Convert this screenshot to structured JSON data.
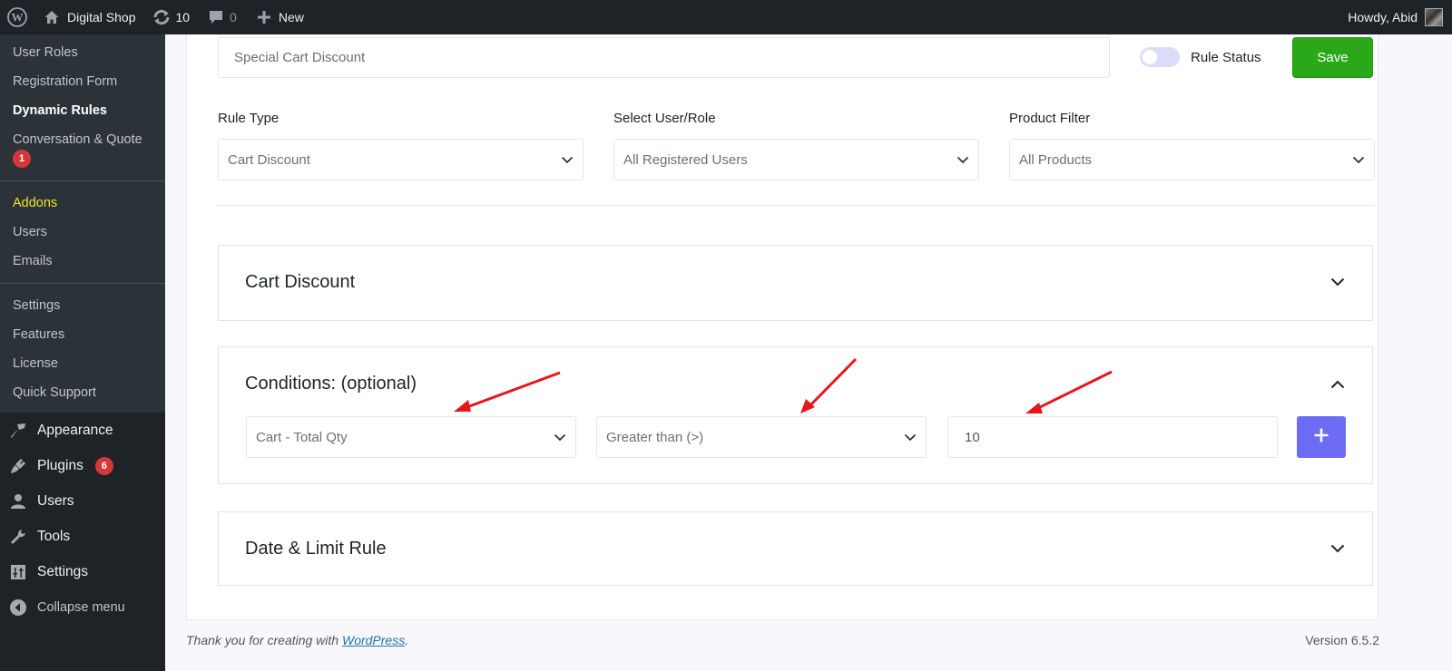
{
  "adminbar": {
    "site_name": "Digital Shop",
    "updates_count": "10",
    "comments_count": "0",
    "new_label": "New",
    "howdy": "Howdy, Abid",
    "icons": [
      "wordpress-logo-icon",
      "home-icon",
      "updates-icon",
      "comment-icon",
      "plus-icon",
      "avatar"
    ]
  },
  "sidebar": {
    "submenu_group1": [
      {
        "label": "User Roles"
      },
      {
        "label": "Registration Form"
      },
      {
        "label": "Dynamic Rules",
        "current": true
      },
      {
        "label": "Conversation & Quote",
        "badge": "1"
      }
    ],
    "submenu_group2": [
      {
        "label": "Addons",
        "highlight": true
      },
      {
        "label": "Users"
      },
      {
        "label": "Emails"
      }
    ],
    "submenu_group3": [
      {
        "label": "Settings"
      },
      {
        "label": "Features"
      },
      {
        "label": "License"
      },
      {
        "label": "Quick Support"
      }
    ],
    "menu": [
      {
        "label": "Appearance",
        "icon": "paintbrush-icon"
      },
      {
        "label": "Plugins",
        "icon": "plugin-icon",
        "badge": "6"
      },
      {
        "label": "Users",
        "icon": "user-icon"
      },
      {
        "label": "Tools",
        "icon": "wrench-icon"
      },
      {
        "label": "Settings",
        "icon": "settings-sliders-icon"
      }
    ],
    "collapse_label": "Collapse menu"
  },
  "rule": {
    "title_value": "Special Cart Discount",
    "status_label": "Rule Status",
    "status_on": false,
    "save_label": "Save",
    "fields": {
      "rule_type": {
        "label": "Rule Type",
        "value": "Cart Discount"
      },
      "user_role": {
        "label": "Select User/Role",
        "value": "All Registered Users"
      },
      "product_filter": {
        "label": "Product Filter",
        "value": "All Products"
      }
    }
  },
  "sections": {
    "cart_discount": {
      "title": "Cart Discount",
      "expanded": false
    },
    "conditions": {
      "title": "Conditions: (optional)",
      "expanded": true,
      "condition_type": "Cart - Total Qty",
      "operator": "Greater than (>)",
      "value": "10",
      "add_label": "+"
    },
    "date_limit": {
      "title": "Date & Limit Rule",
      "expanded": false
    }
  },
  "annotations": {
    "arrow_color": "#e8151b",
    "arrow_count": 3
  },
  "colors": {
    "save_green": "#2aa81a",
    "add_purple": "#6c6cf5",
    "toggle_off": "#dcdcf8",
    "badge_red": "#d63638",
    "addons_yellow": "#f0e12a"
  },
  "footer": {
    "thanks_prefix": "Thank you for creating with ",
    "wordpress_link": "WordPress",
    "thanks_suffix": ".",
    "version": "Version 6.5.2"
  }
}
